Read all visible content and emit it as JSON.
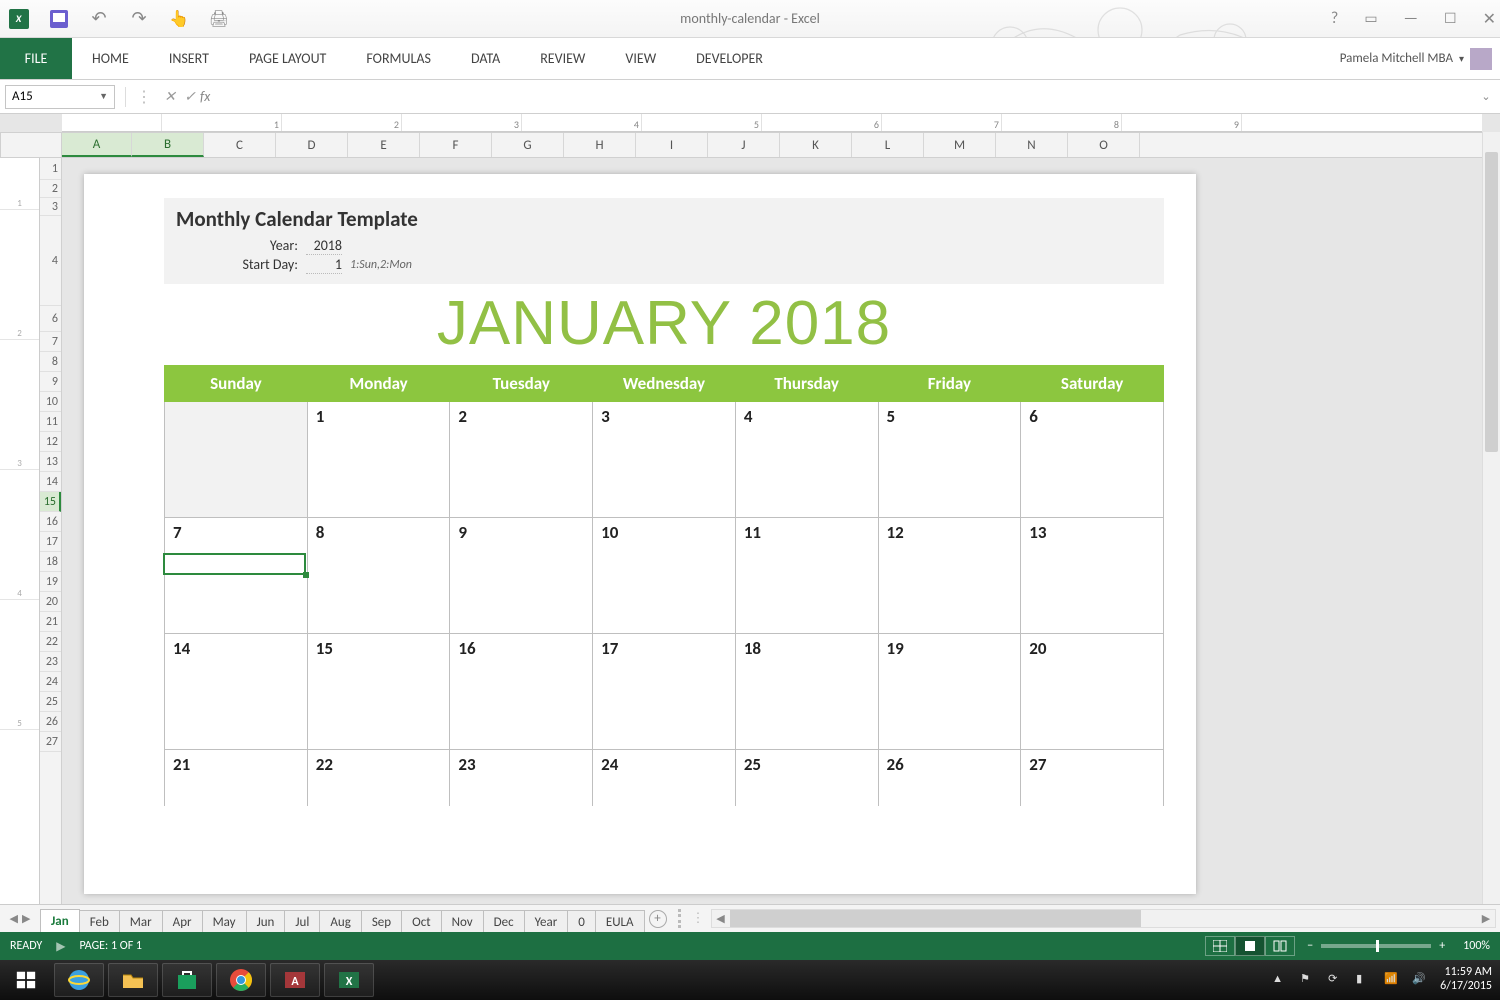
{
  "title": "monthly-calendar - Excel",
  "ribbon": {
    "file": "FILE",
    "tabs": [
      "HOME",
      "INSERT",
      "PAGE LAYOUT",
      "FORMULAS",
      "DATA",
      "REVIEW",
      "VIEW",
      "DEVELOPER"
    ],
    "user": "Pamela Mitchell MBA"
  },
  "formula_bar": {
    "name_box": "A15",
    "formula": ""
  },
  "columns": [
    "A",
    "B",
    "C",
    "D",
    "E",
    "F",
    "G",
    "H",
    "I",
    "J",
    "K",
    "L",
    "M",
    "N",
    "O"
  ],
  "rows": [
    "1",
    "2",
    "3",
    "4",
    "6",
    "7",
    "8",
    "9",
    "10",
    "11",
    "12",
    "13",
    "14",
    "15",
    "16",
    "17",
    "18",
    "19",
    "20",
    "21",
    "22",
    "23",
    "24",
    "25",
    "26",
    "27"
  ],
  "selected_row": "15",
  "template": {
    "title": "Monthly Calendar Template",
    "year_label": "Year:",
    "year_value": "2018",
    "startday_label": "Start Day:",
    "startday_value": "1",
    "startday_hint": "1:Sun,2:Mon"
  },
  "month_title": "JANUARY 2018",
  "weekdays": [
    "Sunday",
    "Monday",
    "Tuesday",
    "Wednesday",
    "Thursday",
    "Friday",
    "Saturday"
  ],
  "calendar_rows": [
    [
      "",
      "1",
      "2",
      "3",
      "4",
      "5",
      "6"
    ],
    [
      "7",
      "8",
      "9",
      "10",
      "11",
      "12",
      "13"
    ],
    [
      "14",
      "15",
      "16",
      "17",
      "18",
      "19",
      "20"
    ],
    [
      "21",
      "22",
      "23",
      "24",
      "25",
      "26",
      "27"
    ]
  ],
  "sheet_tabs": [
    "Jan",
    "Feb",
    "Mar",
    "Apr",
    "May",
    "Jun",
    "Jul",
    "Aug",
    "Sep",
    "Oct",
    "Nov",
    "Dec",
    "Year",
    "0",
    "EULA"
  ],
  "active_sheet": "Jan",
  "status": {
    "ready": "READY",
    "page": "PAGE: 1 OF 1",
    "zoom": "100%"
  },
  "tray": {
    "time": "11:59 AM",
    "date": "6/17/2015"
  },
  "ruler_marks": [
    "1",
    "2",
    "3",
    "4",
    "5",
    "6",
    "7",
    "8",
    "9"
  ]
}
